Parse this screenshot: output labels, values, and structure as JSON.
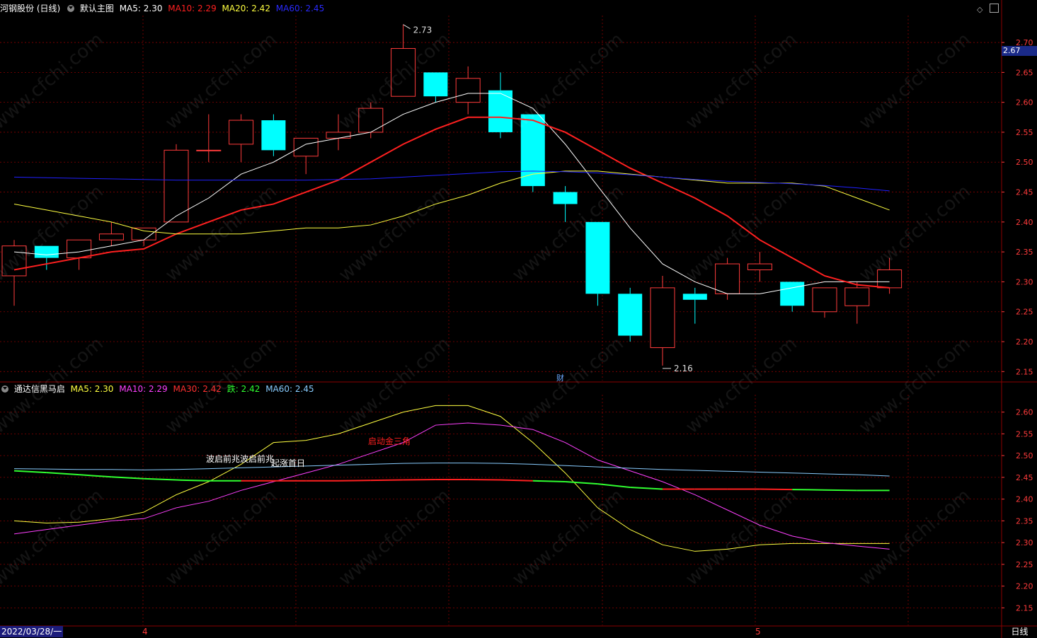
{
  "main_panel": {
    "stock": "河钢股份 (日线)",
    "chart_name": "默认主图",
    "indicators": [
      {
        "label": "MA5: 2.30",
        "color": "#ffffff"
      },
      {
        "label": "MA10: 2.29",
        "color": "#ff2020"
      },
      {
        "label": "MA20: 2.42",
        "color": "#ffff40"
      },
      {
        "label": "MA60: 2.45",
        "color": "#2020ff"
      }
    ],
    "high_label": "2.73",
    "low_label": "2.16",
    "current_price": "2.67",
    "fin_marker": "财"
  },
  "sub_panel": {
    "title": "通达信黑马启",
    "indicators": [
      {
        "label": "MA5: 2.30",
        "color": "#ffff40"
      },
      {
        "label": "MA10: 2.29",
        "color": "#ff40ff"
      },
      {
        "label": "MA30: 2.42",
        "color": "#ff3030"
      },
      {
        "label": "跌: 2.42",
        "color": "#30ff30"
      },
      {
        "label": "MA60: 2.45",
        "color": "#88ccff"
      }
    ],
    "annotations": [
      {
        "text": "波启前兆波启前兆",
        "color": "#ffffff"
      },
      {
        "text": "起涨首日",
        "color": "#ffffff"
      },
      {
        "text": "启动金三角",
        "color": "#ff2020"
      }
    ]
  },
  "footer": {
    "date": "2022/03/28/一",
    "month_ticks": [
      "4",
      "5"
    ],
    "period": "日线"
  },
  "watermark": "www.cfchi.com",
  "colors": {
    "up": "#ff3b3b",
    "down": "#00ffff",
    "grid": "#8a0000",
    "axis": "#ff3b3b"
  },
  "chart_data": [
    {
      "type": "candlestick",
      "y_axis_ticks": [
        "2.70",
        "2.65",
        "2.60",
        "2.55",
        "2.50",
        "2.45",
        "2.40",
        "2.35",
        "2.30",
        "2.25",
        "2.20",
        "2.15"
      ],
      "ylim": [
        2.135,
        2.745
      ],
      "candles": [
        {
          "o": 2.31,
          "h": 2.37,
          "l": 2.26,
          "c": 2.36
        },
        {
          "o": 2.36,
          "h": 2.36,
          "l": 2.32,
          "c": 2.34
        },
        {
          "o": 2.34,
          "h": 2.37,
          "l": 2.32,
          "c": 2.37
        },
        {
          "o": 2.37,
          "h": 2.4,
          "l": 2.36,
          "c": 2.38
        },
        {
          "o": 2.37,
          "h": 2.39,
          "l": 2.36,
          "c": 2.39
        },
        {
          "o": 2.4,
          "h": 2.53,
          "l": 2.4,
          "c": 2.52
        },
        {
          "o": 2.52,
          "h": 2.58,
          "l": 2.5,
          "c": 2.52
        },
        {
          "o": 2.53,
          "h": 2.58,
          "l": 2.5,
          "c": 2.57
        },
        {
          "o": 2.57,
          "h": 2.58,
          "l": 2.51,
          "c": 2.52
        },
        {
          "o": 2.51,
          "h": 2.54,
          "l": 2.48,
          "c": 2.54
        },
        {
          "o": 2.54,
          "h": 2.58,
          "l": 2.52,
          "c": 2.55
        },
        {
          "o": 2.55,
          "h": 2.6,
          "l": 2.54,
          "c": 2.59
        },
        {
          "o": 2.61,
          "h": 2.73,
          "l": 2.61,
          "c": 2.69
        },
        {
          "o": 2.65,
          "h": 2.65,
          "l": 2.6,
          "c": 2.61
        },
        {
          "o": 2.6,
          "h": 2.66,
          "l": 2.58,
          "c": 2.64
        },
        {
          "o": 2.62,
          "h": 2.65,
          "l": 2.54,
          "c": 2.55
        },
        {
          "o": 2.58,
          "h": 2.58,
          "l": 2.45,
          "c": 2.46
        },
        {
          "o": 2.45,
          "h": 2.46,
          "l": 2.4,
          "c": 2.43
        },
        {
          "o": 2.4,
          "h": 2.4,
          "l": 2.26,
          "c": 2.28
        },
        {
          "o": 2.28,
          "h": 2.29,
          "l": 2.2,
          "c": 2.21
        },
        {
          "o": 2.19,
          "h": 2.31,
          "l": 2.16,
          "c": 2.29
        },
        {
          "o": 2.28,
          "h": 2.29,
          "l": 2.23,
          "c": 2.27
        },
        {
          "o": 2.28,
          "h": 2.34,
          "l": 2.27,
          "c": 2.33
        },
        {
          "o": 2.32,
          "h": 2.35,
          "l": 2.3,
          "c": 2.33
        },
        {
          "o": 2.3,
          "h": 2.3,
          "l": 2.25,
          "c": 2.26
        },
        {
          "o": 2.25,
          "h": 2.29,
          "l": 2.24,
          "c": 2.29
        },
        {
          "o": 2.26,
          "h": 2.3,
          "l": 2.23,
          "c": 2.29
        },
        {
          "o": 2.29,
          "h": 2.34,
          "l": 2.28,
          "c": 2.32
        }
      ],
      "series": [
        {
          "name": "MA5",
          "color": "#ffffff",
          "values": [
            2.35,
            2.345,
            2.35,
            2.36,
            2.37,
            2.41,
            2.44,
            2.48,
            2.5,
            2.53,
            2.54,
            2.55,
            2.58,
            2.6,
            2.615,
            2.615,
            2.59,
            2.53,
            2.46,
            2.39,
            2.33,
            2.3,
            2.28,
            2.28,
            2.29,
            2.3,
            2.3,
            2.3
          ]
        },
        {
          "name": "MA10",
          "color": "#ff2020",
          "values": [
            2.32,
            2.33,
            2.34,
            2.35,
            2.355,
            2.38,
            2.4,
            2.42,
            2.43,
            2.45,
            2.47,
            2.5,
            2.53,
            2.555,
            2.575,
            2.575,
            2.57,
            2.55,
            2.52,
            2.49,
            2.465,
            2.44,
            2.41,
            2.37,
            2.34,
            2.31,
            2.295,
            2.29
          ]
        },
        {
          "name": "MA20",
          "color": "#ffff40",
          "values": [
            2.43,
            2.42,
            2.41,
            2.4,
            2.385,
            2.38,
            2.38,
            2.38,
            2.385,
            2.39,
            2.39,
            2.395,
            2.41,
            2.43,
            2.445,
            2.465,
            2.48,
            2.485,
            2.485,
            2.48,
            2.475,
            2.47,
            2.465,
            2.465,
            2.465,
            2.46,
            2.44,
            2.42
          ]
        },
        {
          "name": "MA60",
          "color": "#2020ff",
          "values": [
            2.475,
            2.474,
            2.473,
            2.472,
            2.471,
            2.47,
            2.47,
            2.47,
            2.47,
            2.47,
            2.471,
            2.472,
            2.475,
            2.478,
            2.481,
            2.484,
            2.485,
            2.484,
            2.482,
            2.479,
            2.475,
            2.471,
            2.468,
            2.466,
            2.464,
            2.461,
            2.457,
            2.452
          ]
        }
      ]
    },
    {
      "type": "line",
      "y_axis_ticks": [
        "2.60",
        "2.55",
        "2.50",
        "2.45",
        "2.40",
        "2.35",
        "2.30",
        "2.25",
        "2.20",
        "2.15"
      ],
      "ylim": [
        2.11,
        2.64
      ],
      "series": [
        {
          "name": "MA5",
          "color": "#ffff40",
          "values": [
            2.35,
            2.345,
            2.347,
            2.355,
            2.37,
            2.41,
            2.44,
            2.48,
            2.53,
            2.535,
            2.55,
            2.575,
            2.6,
            2.615,
            2.615,
            2.59,
            2.53,
            2.46,
            2.38,
            2.33,
            2.295,
            2.28,
            2.285,
            2.295,
            2.298,
            2.298,
            2.298,
            2.298
          ]
        },
        {
          "name": "MA10",
          "color": "#ff40ff",
          "values": [
            2.32,
            2.33,
            2.34,
            2.35,
            2.355,
            2.38,
            2.395,
            2.42,
            2.44,
            2.46,
            2.48,
            2.505,
            2.53,
            2.57,
            2.575,
            2.57,
            2.56,
            2.53,
            2.49,
            2.465,
            2.44,
            2.41,
            2.375,
            2.34,
            2.315,
            2.3,
            2.292,
            2.285
          ]
        },
        {
          "name": "跌",
          "color": "#30ff30",
          "values": [
            2.465,
            2.461,
            2.456,
            2.451,
            2.447,
            2.444,
            2.442,
            2.442,
            2.442,
            2.442,
            2.442,
            2.443,
            2.444,
            2.445,
            2.445,
            2.444,
            2.442,
            2.44,
            2.435,
            2.427,
            2.423,
            2.423,
            2.423,
            2.423,
            2.422,
            2.421,
            2.42,
            2.42
          ]
        },
        {
          "name": "MA60",
          "color": "#88ccff",
          "values": [
            2.47,
            2.469,
            2.468,
            2.468,
            2.467,
            2.468,
            2.47,
            2.472,
            2.474,
            2.476,
            2.478,
            2.48,
            2.482,
            2.483,
            2.483,
            2.482,
            2.48,
            2.477,
            2.474,
            2.471,
            2.468,
            2.466,
            2.464,
            2.462,
            2.46,
            2.458,
            2.456,
            2.453
          ]
        }
      ]
    }
  ]
}
